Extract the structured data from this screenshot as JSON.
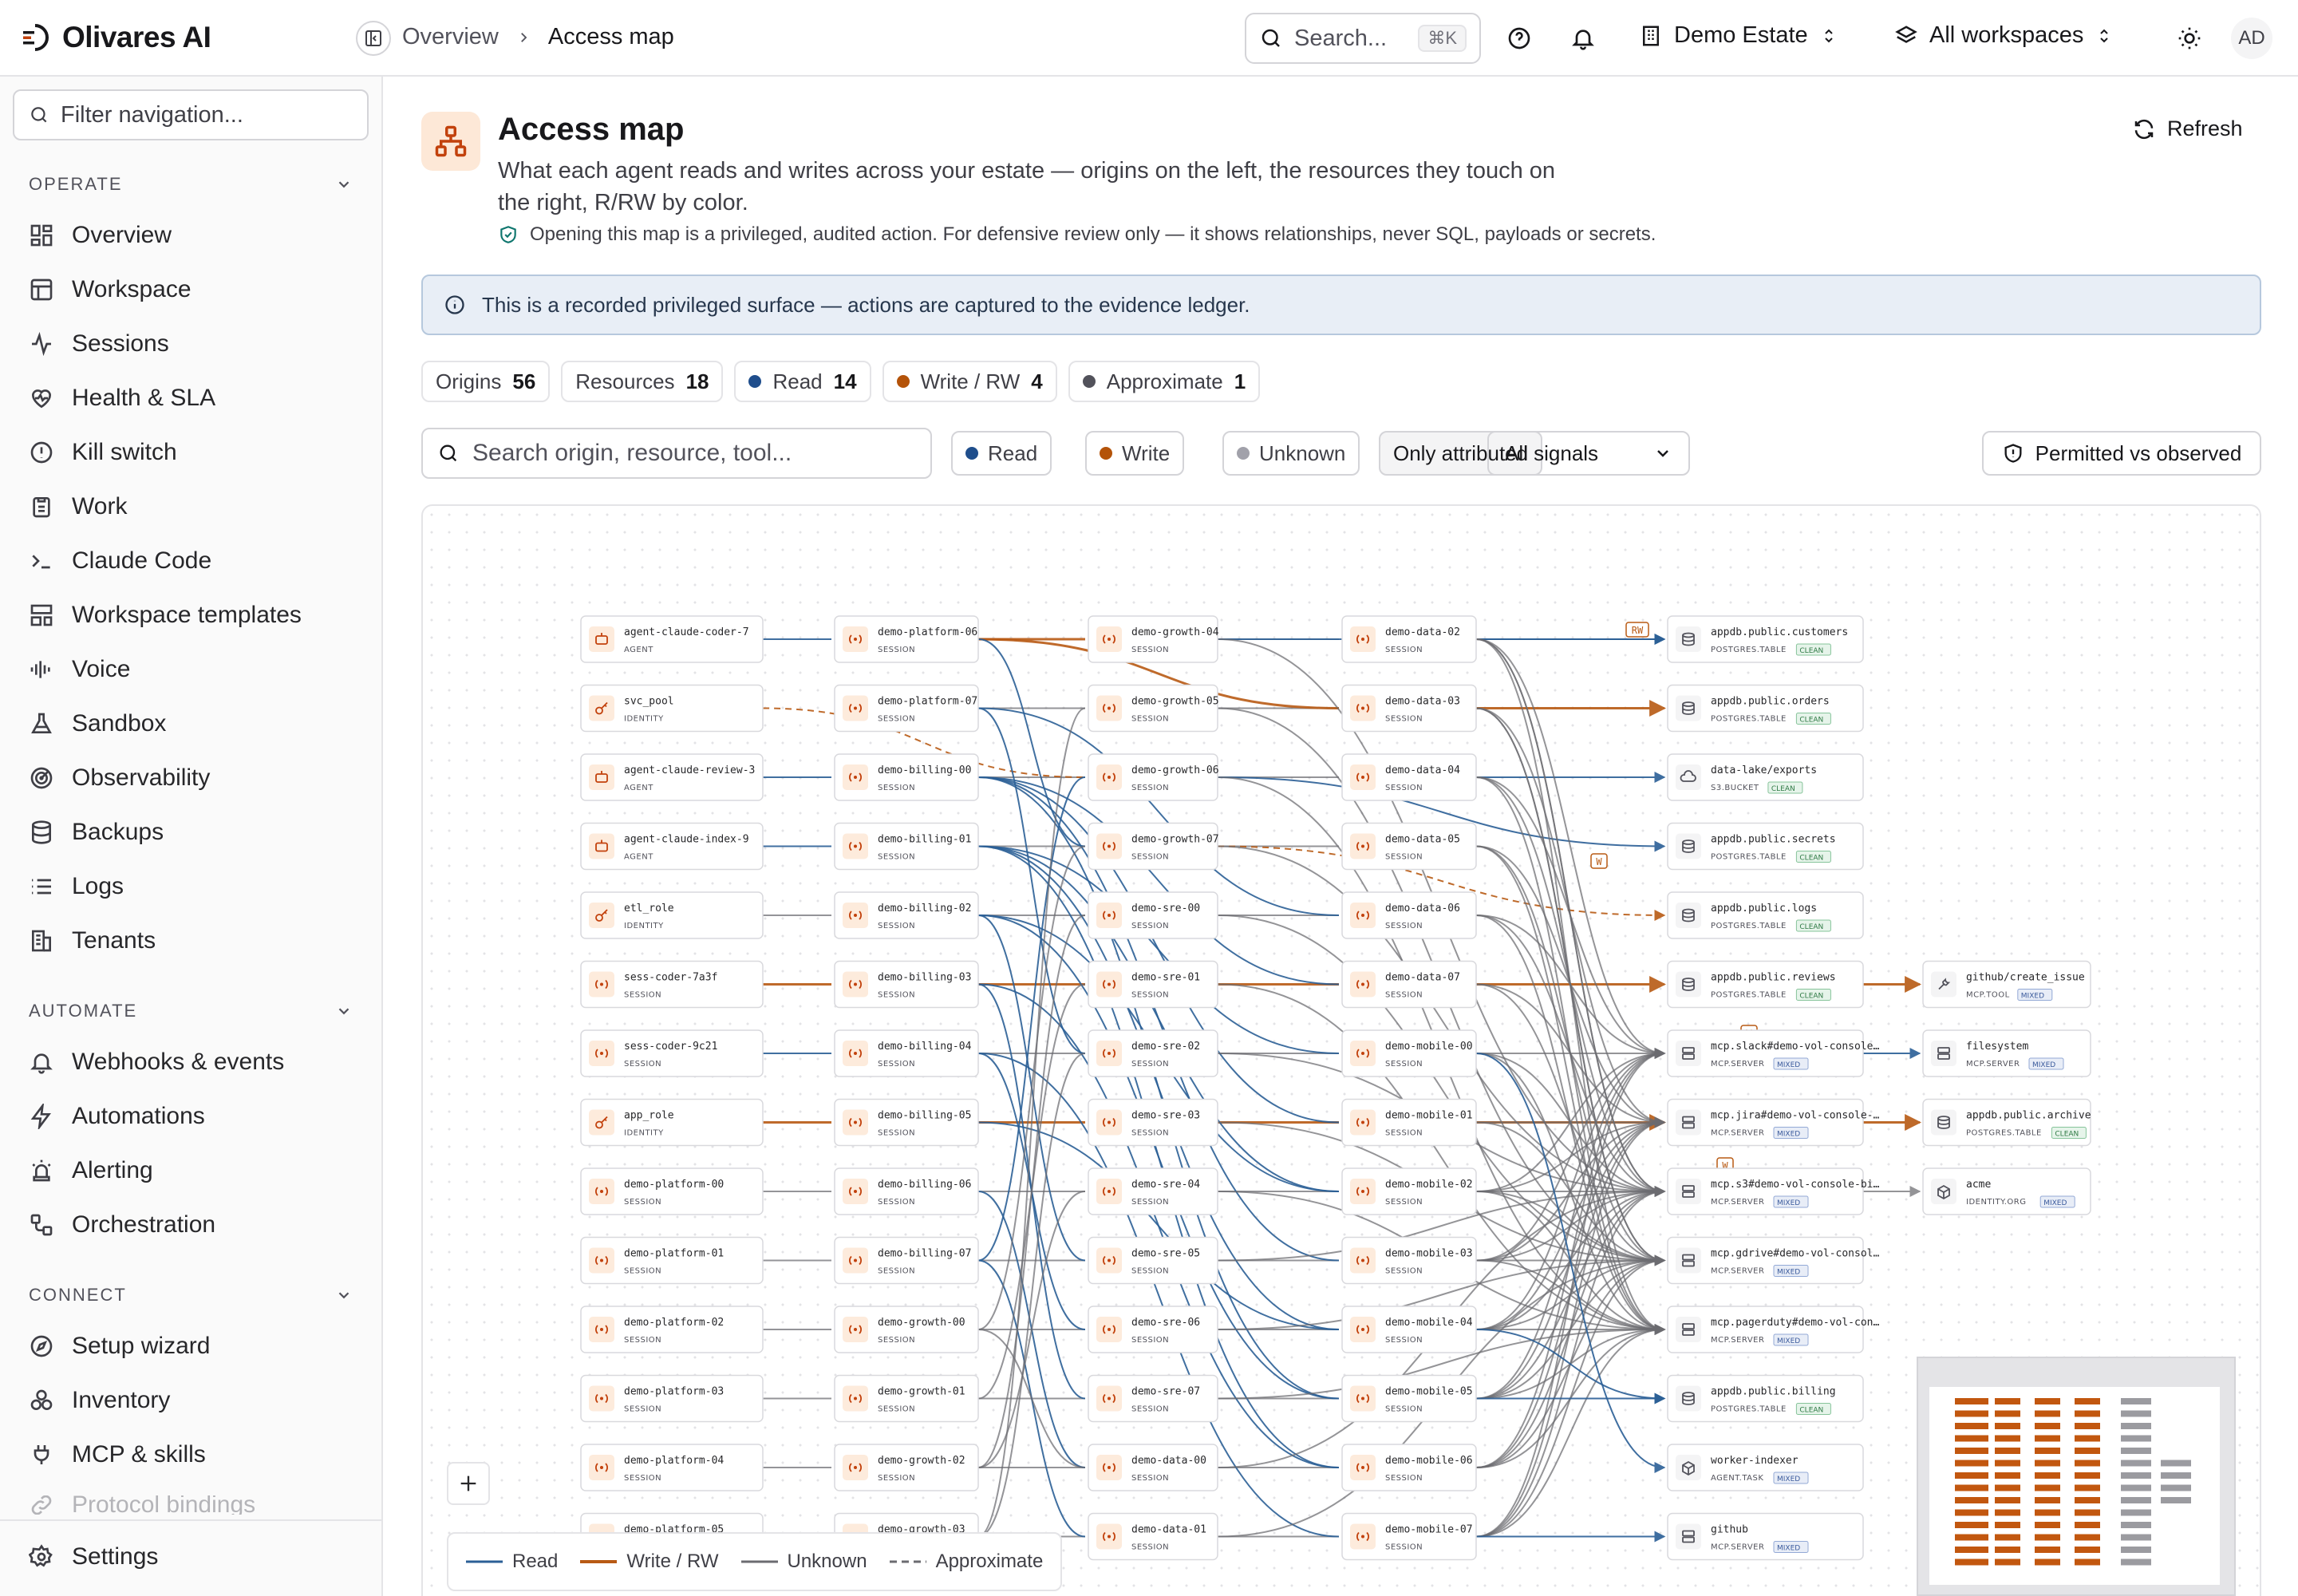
{
  "brand": {
    "name": "Olivares AI"
  },
  "breadcrumb": {
    "parent": "Overview",
    "current": "Access map"
  },
  "topbar": {
    "search_placeholder": "Search...",
    "search_shortcut": "⌘K",
    "org": "Demo Estate",
    "workspace": "All workspaces",
    "avatar": "AD"
  },
  "sidebar": {
    "filter_placeholder": "Filter navigation...",
    "sections": [
      {
        "title": "OPERATE",
        "items": [
          "Overview",
          "Workspace",
          "Sessions",
          "Health & SLA",
          "Kill switch",
          "Work",
          "Claude Code",
          "Workspace templates",
          "Voice",
          "Sandbox",
          "Observability",
          "Backups",
          "Logs",
          "Tenants"
        ]
      },
      {
        "title": "AUTOMATE",
        "items": [
          "Webhooks & events",
          "Automations",
          "Alerting",
          "Orchestration"
        ]
      },
      {
        "title": "CONNECT",
        "items": [
          "Setup wizard",
          "Inventory",
          "MCP & skills",
          "Protocol bindings"
        ]
      }
    ],
    "settings": "Settings"
  },
  "page": {
    "title": "Access map",
    "subtitle": "What each agent reads and writes across your estate — origins on the left, the resources they touch on the right, R/RW by color.",
    "notice": "Opening this map is a privileged, audited action. For defensive review only — it shows relationships, never SQL, payloads or secrets.",
    "refresh": "Refresh",
    "banner": "This is a recorded privileged surface — actions are captured to the evidence ledger."
  },
  "stats": [
    {
      "label": "Origins",
      "value": "56"
    },
    {
      "label": "Resources",
      "value": "18"
    },
    {
      "label": "Read",
      "value": "14",
      "color": "#1f4e8c"
    },
    {
      "label": "Write / RW",
      "value": "4",
      "color": "#b45309"
    },
    {
      "label": "Approximate",
      "value": "1",
      "color": "#52525b"
    }
  ],
  "filters": {
    "search_placeholder": "Search origin, resource, tool...",
    "read": "Read",
    "write": "Write",
    "unknown": "Unknown",
    "only_attributed": "Only attributed",
    "signals": "All signals",
    "permitted": "Permitted vs observed"
  },
  "colors": {
    "read": "#2b5f96",
    "write": "#b85a14",
    "unknown": "#6b6b70",
    "accent": "#c2410c"
  },
  "legend": {
    "read": "Read",
    "write": "Write / RW",
    "unknown": "Unknown",
    "approx": "Approximate"
  },
  "graph": {
    "col0": [
      {
        "name": "agent-claude-coder-7",
        "type": "AGENT",
        "icon": "agent"
      },
      {
        "name": "svc_pool",
        "type": "IDENTITY",
        "icon": "key"
      },
      {
        "name": "agent-claude-review-3",
        "type": "AGENT",
        "icon": "agent"
      },
      {
        "name": "agent-claude-index-9",
        "type": "AGENT",
        "icon": "agent"
      },
      {
        "name": "etl_role",
        "type": "IDENTITY",
        "icon": "key"
      },
      {
        "name": "sess-coder-7a3f",
        "type": "SESSION",
        "icon": "session"
      },
      {
        "name": "sess-coder-9c21",
        "type": "SESSION",
        "icon": "session"
      },
      {
        "name": "app_role",
        "type": "IDENTITY",
        "icon": "key"
      },
      {
        "name": "demo-platform-00",
        "type": "SESSION",
        "icon": "session"
      },
      {
        "name": "demo-platform-01",
        "type": "SESSION",
        "icon": "session"
      },
      {
        "name": "demo-platform-02",
        "type": "SESSION",
        "icon": "session"
      },
      {
        "name": "demo-platform-03",
        "type": "SESSION",
        "icon": "session"
      },
      {
        "name": "demo-platform-04",
        "type": "SESSION",
        "icon": "session"
      },
      {
        "name": "demo-platform-05",
        "type": "SESSION",
        "icon": "session"
      }
    ],
    "col1": [
      "demo-platform-06",
      "demo-platform-07",
      "demo-billing-00",
      "demo-billing-01",
      "demo-billing-02",
      "demo-billing-03",
      "demo-billing-04",
      "demo-billing-05",
      "demo-billing-06",
      "demo-billing-07",
      "demo-growth-00",
      "demo-growth-01",
      "demo-growth-02",
      "demo-growth-03"
    ],
    "col2": [
      "demo-growth-04",
      "demo-growth-05",
      "demo-growth-06",
      "demo-growth-07",
      "demo-sre-00",
      "demo-sre-01",
      "demo-sre-02",
      "demo-sre-03",
      "demo-sre-04",
      "demo-sre-05",
      "demo-sre-06",
      "demo-sre-07",
      "demo-data-00",
      "demo-data-01"
    ],
    "col3": [
      "demo-data-02",
      "demo-data-03",
      "demo-data-04",
      "demo-data-05",
      "demo-data-06",
      "demo-data-07",
      "demo-mobile-00",
      "demo-mobile-01",
      "demo-mobile-02",
      "demo-mobile-03",
      "demo-mobile-04",
      "demo-mobile-05",
      "demo-mobile-06",
      "demo-mobile-07"
    ],
    "session_type": "SESSION",
    "resources": [
      {
        "name": "appdb.public.customers",
        "type": "POSTGRES.TABLE",
        "badge": "CLEAN",
        "icon": "db"
      },
      {
        "name": "appdb.public.orders",
        "type": "POSTGRES.TABLE",
        "badge": "CLEAN",
        "icon": "db"
      },
      {
        "name": "data-lake/exports",
        "type": "S3.BUCKET",
        "badge": "CLEAN",
        "icon": "cloud"
      },
      {
        "name": "appdb.public.secrets",
        "type": "POSTGRES.TABLE",
        "badge": "CLEAN",
        "icon": "db"
      },
      {
        "name": "appdb.public.logs",
        "type": "POSTGRES.TABLE",
        "badge": "CLEAN",
        "icon": "db"
      },
      {
        "name": "appdb.public.reviews",
        "type": "POSTGRES.TABLE",
        "badge": "CLEAN",
        "icon": "db"
      },
      {
        "name": "mcp.slack#demo-vol-console…",
        "type": "MCP.SERVER",
        "badge": "MIXED",
        "icon": "server"
      },
      {
        "name": "mcp.jira#demo-vol-console-…",
        "type": "MCP.SERVER",
        "badge": "MIXED",
        "icon": "server"
      },
      {
        "name": "mcp.s3#demo-vol-console-bi…",
        "type": "MCP.SERVER",
        "badge": "MIXED",
        "icon": "server"
      },
      {
        "name": "mcp.gdrive#demo-vol-consol…",
        "type": "MCP.SERVER",
        "badge": "MIXED",
        "icon": "server"
      },
      {
        "name": "mcp.pagerduty#demo-vol-con…",
        "type": "MCP.SERVER",
        "badge": "MIXED",
        "icon": "server"
      },
      {
        "name": "appdb.public.billing",
        "type": "POSTGRES.TABLE",
        "badge": "CLEAN",
        "icon": "db"
      },
      {
        "name": "worker-indexer",
        "type": "AGENT.TASK",
        "badge": "MIXED",
        "icon": "box"
      },
      {
        "name": "github",
        "type": "MCP.SERVER",
        "badge": "MIXED",
        "icon": "server"
      }
    ],
    "downstream": [
      {
        "name": "github/create_issue",
        "type": "MCP.TOOL",
        "badge": "MIXED",
        "icon": "tool",
        "row": 5
      },
      {
        "name": "filesystem",
        "type": "MCP.SERVER",
        "badge": "MIXED",
        "icon": "server",
        "row": 6
      },
      {
        "name": "appdb.public.archive",
        "type": "POSTGRES.TABLE",
        "badge": "CLEAN",
        "icon": "db",
        "row": 7
      },
      {
        "name": "acme",
        "type": "IDENTITY.ORG",
        "badge": "MIXED",
        "icon": "box",
        "row": 8
      }
    ],
    "edge_labels": [
      {
        "text": "RW"
      },
      {
        "text": "W"
      },
      {
        "text": "W"
      },
      {
        "text": "W"
      }
    ]
  }
}
